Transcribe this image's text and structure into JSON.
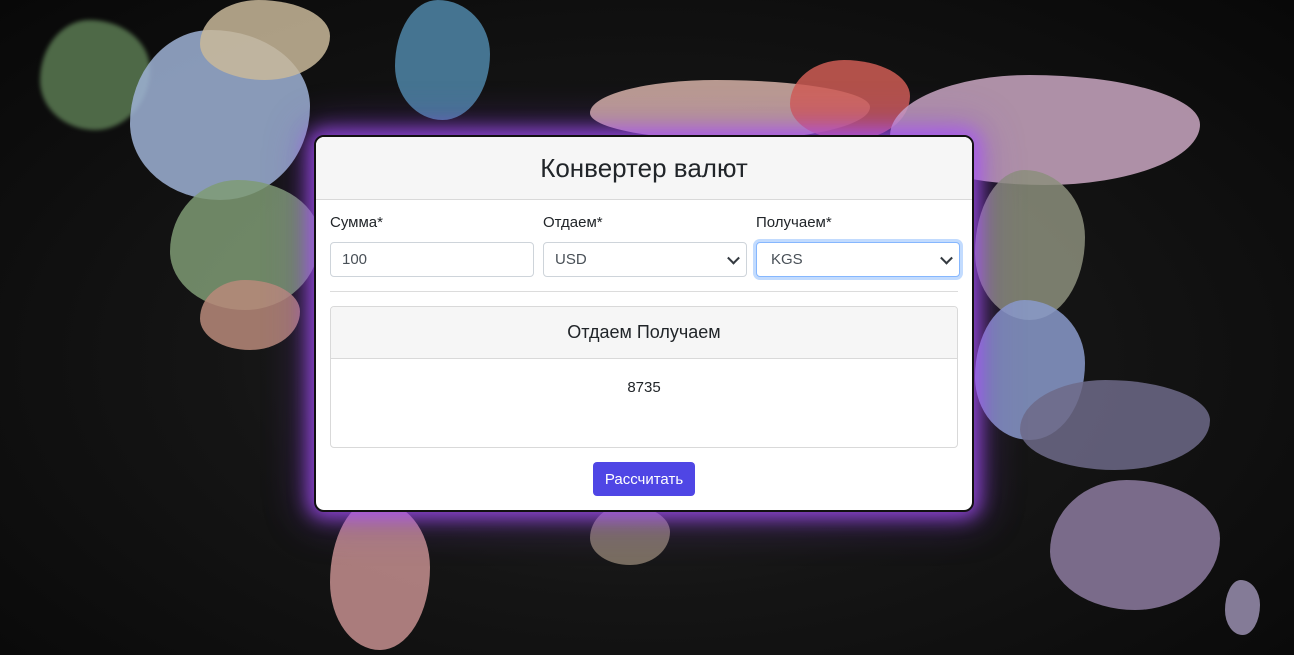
{
  "title": "Конвертер валют",
  "form": {
    "amount": {
      "label": "Сумма*",
      "value": "100"
    },
    "from": {
      "label": "Отдаем*",
      "value": "USD"
    },
    "to": {
      "label": "Получаем*",
      "value": "KGS"
    }
  },
  "result": {
    "header_from": "Отдаем",
    "header_to": "Получаем",
    "value": "8735"
  },
  "submit_label": "Рассчитать",
  "colors": {
    "accent_button": "#4f46e5",
    "glow": "#aa50ff",
    "page_background": "#111111"
  }
}
